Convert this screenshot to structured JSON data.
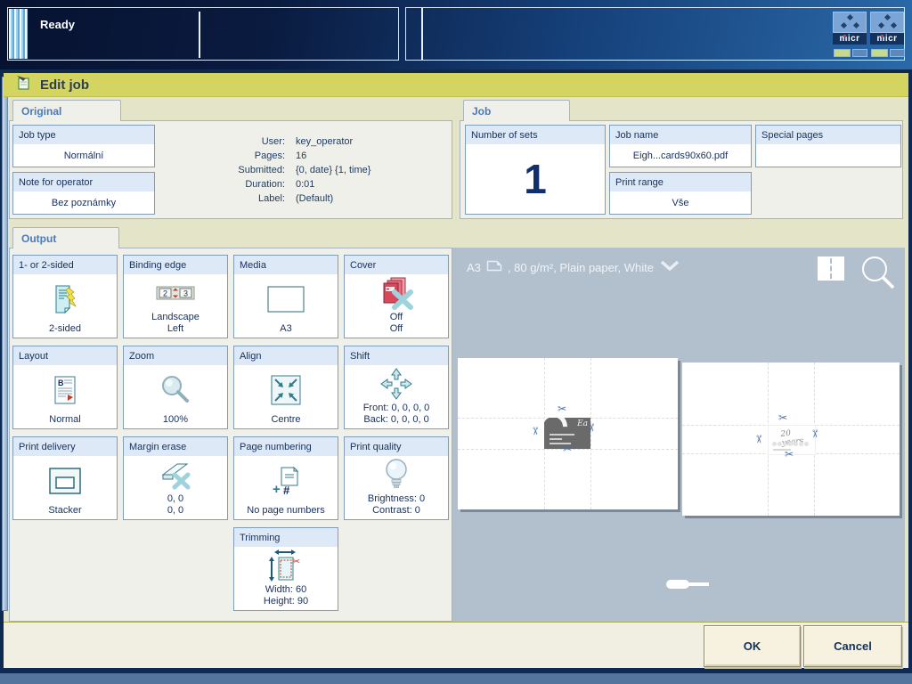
{
  "top_bar": {
    "status": "Ready",
    "printer_icons": [
      {
        "label": "micr"
      },
      {
        "label": "micr"
      }
    ]
  },
  "dialog": {
    "title": "Edit job",
    "original": {
      "tab_label": "Original",
      "job_type": {
        "label": "Job type",
        "value": "Normální"
      },
      "note_for_operator": {
        "label": "Note for operator",
        "value": "Bez poznámky"
      },
      "info": {
        "rows": [
          {
            "label": "User:",
            "value": "key_operator"
          },
          {
            "label": "Pages:",
            "value": "16"
          },
          {
            "label": "Submitted:",
            "value": "{0, date} {1, time}"
          },
          {
            "label": "Duration:",
            "value": "0:01"
          },
          {
            "label": "Label:",
            "value": "(Default)"
          }
        ]
      }
    },
    "job": {
      "tab_label": "Job",
      "number_of_sets": {
        "label": "Number of sets",
        "value": "1"
      },
      "job_name": {
        "label": "Job name",
        "value": "Eigh...cards90x60.pdf"
      },
      "print_range": {
        "label": "Print range",
        "value": "Vše"
      },
      "special_pages": {
        "label": "Special pages",
        "value": ""
      }
    },
    "output": {
      "tab_label": "Output",
      "tiles": [
        {
          "label": "1- or 2-sided",
          "icon": "two-sided-icon",
          "value": "2-sided"
        },
        {
          "label": "Binding edge",
          "icon": "binding-edge-icon",
          "value": "Landscape\nLeft"
        },
        {
          "label": "Media",
          "icon": "media-icon",
          "value": "A3"
        },
        {
          "label": "Cover",
          "icon": "cover-off-icon",
          "value": "Off\nOff"
        },
        {
          "label": "Layout",
          "icon": "layout-icon",
          "value": "Normal"
        },
        {
          "label": "Zoom",
          "icon": "magnifier-icon",
          "value": "100%"
        },
        {
          "label": "Align",
          "icon": "align-centre-icon",
          "value": "Centre"
        },
        {
          "label": "Shift",
          "icon": "shift-arrows-icon",
          "value": "Front: 0, 0, 0, 0\nBack: 0, 0, 0, 0"
        },
        {
          "label": "Print delivery",
          "icon": "stacker-icon",
          "value": "Stacker"
        },
        {
          "label": "Margin erase",
          "icon": "margin-erase-icon",
          "value": "0, 0\n0, 0"
        },
        {
          "label": "Page numbering",
          "icon": "page-numbering-icon",
          "value": "No page numbers"
        },
        {
          "label": "Print quality",
          "icon": "bulb-icon",
          "value": "Brightness: 0\nContrast: 0"
        },
        {
          "label": "Trimming",
          "icon": "trimming-icon",
          "value": "Width: 60\nHeight: 90"
        }
      ]
    },
    "preview": {
      "media_name": "A3",
      "media_details": ", 80 g/m², Plain paper, White"
    },
    "footer": {
      "ok": "OK",
      "cancel": "Cancel"
    }
  },
  "colors": {
    "title_bar": "#d4d560",
    "dialog_bg": "#e4e4c9",
    "preview_bg": "#b2c0ce",
    "accent_navy": "#16305c",
    "tab_label_blue": "#4a7ab8",
    "tile_header": "#dde9f7"
  }
}
